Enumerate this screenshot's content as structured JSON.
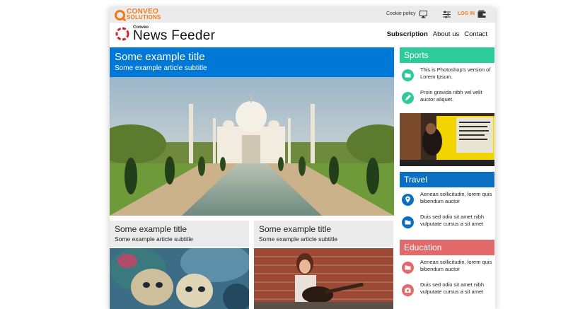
{
  "brand": {
    "line1": "CONVEO",
    "line2": "SOLUTIONS"
  },
  "topbar": {
    "cookie": "Cookie policy",
    "login": "LOG IN"
  },
  "logo": {
    "small": "Conveo",
    "big": "News Feeder"
  },
  "nav": [
    "Subscription",
    "About us",
    "Contact"
  ],
  "hero": {
    "title": "Some example title",
    "subtitle": "Some example article subtitle"
  },
  "cards": [
    {
      "title": "Some example title",
      "subtitle": "Some example article subtitle"
    },
    {
      "title": "Some example title",
      "subtitle": "Some example article subtitle"
    }
  ],
  "sections": [
    {
      "title": "Sports",
      "color": "#2ecb9a",
      "items": [
        {
          "icon": "folder-icon",
          "text": "This is Photoshop's version of Lorem Ipsum."
        },
        {
          "icon": "pencil-icon",
          "text": "Proin gravida nibh vel velit auctor aliquet."
        }
      ]
    },
    {
      "title": "Travel",
      "color": "#0a6fc2",
      "items": [
        {
          "icon": "location-pin-icon",
          "text": "Aenean sollicitudin, lorem quis bibendum auctor"
        },
        {
          "icon": "folder-icon",
          "text": "Duis sed odio sit amet nibh vulputate cursus a sit amet"
        }
      ]
    },
    {
      "title": "Education",
      "color": "#e36a6a",
      "items": [
        {
          "icon": "folder-icon",
          "text": "Aenean sollicitudin, lorem quis bibendum auctor"
        },
        {
          "icon": "camera-icon",
          "text": "Duis sed odio sit amet nibh vulputate cursus a sit amet"
        }
      ]
    }
  ]
}
